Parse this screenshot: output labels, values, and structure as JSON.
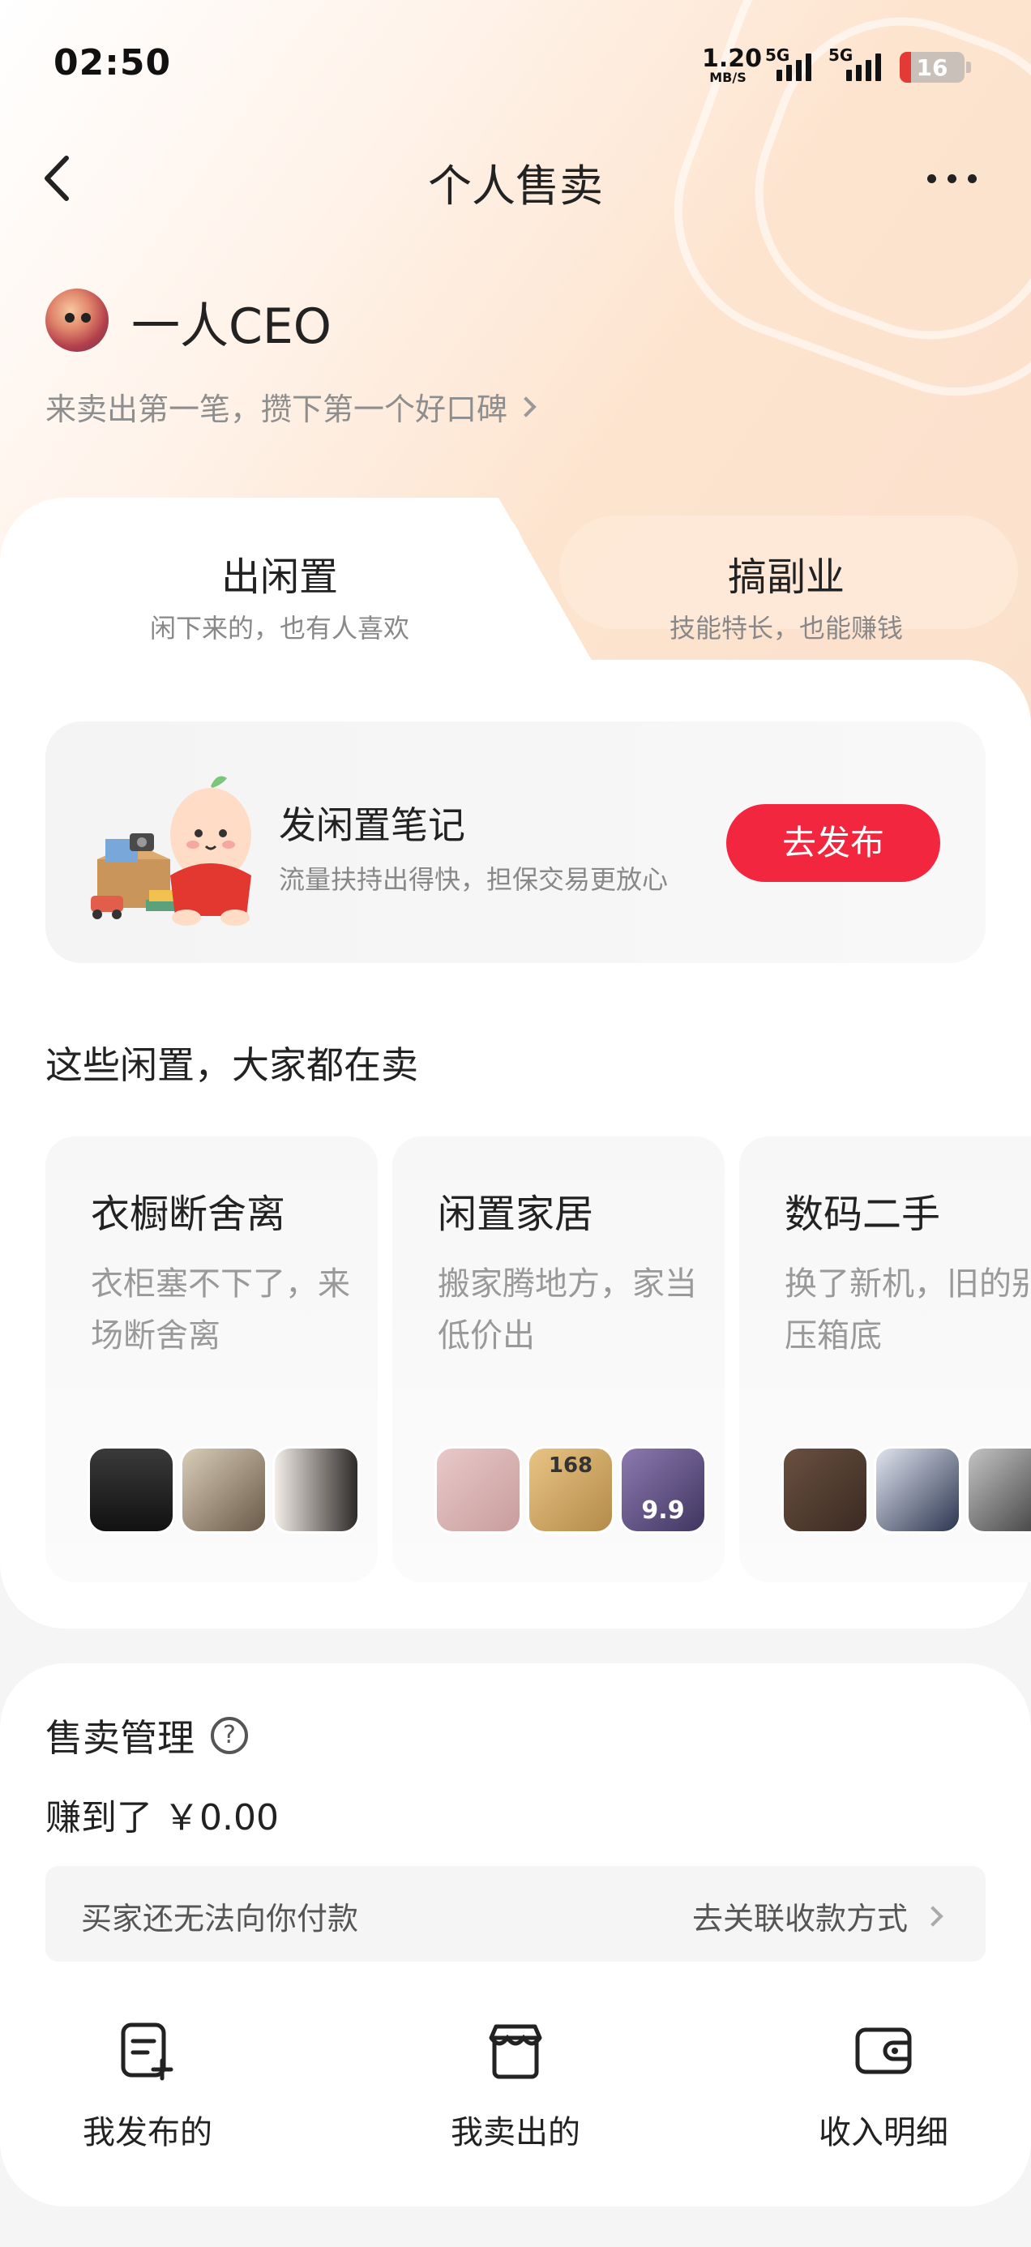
{
  "status_bar": {
    "time": "02:50",
    "net_speed_value": "1.20",
    "net_speed_unit": "MB/S",
    "signal1_label": "5G",
    "signal2_label": "5G",
    "battery": "16"
  },
  "nav": {
    "title": "个人售卖"
  },
  "profile": {
    "username": "一人CEO",
    "subtitle": "来卖出第一笔，攒下第一个好口碑"
  },
  "tabs": [
    {
      "title": "出闲置",
      "subtitle": "闲下来的，也有人喜欢"
    },
    {
      "title": "搞副业",
      "subtitle": "技能特长，也能赚钱"
    }
  ],
  "publish": {
    "title": "发闲置笔记",
    "subtitle": "流量扶持出得快，担保交易更放心",
    "button": "去发布"
  },
  "section_title": "这些闲置，大家都在卖",
  "categories": [
    {
      "title": "衣橱断舍离",
      "desc": "衣柜塞不下了，来场断舍离"
    },
    {
      "title": "闲置家居",
      "desc": "搬家腾地方，家当低价出",
      "thumb_labels": [
        "168",
        "9.9"
      ]
    },
    {
      "title": "数码二手",
      "desc": "换了新机，旧的别压箱底"
    }
  ],
  "sales": {
    "title": "售卖管理",
    "earned": "赚到了 ￥0.00",
    "pay_notice": "买家还无法向你付款",
    "pay_action": "去关联收款方式",
    "quick_actions": [
      {
        "label": "我发布的",
        "icon": "edit-note-icon"
      },
      {
        "label": "我卖出的",
        "icon": "store-box-icon"
      },
      {
        "label": "收入明细",
        "icon": "wallet-icon"
      }
    ]
  },
  "colors": {
    "accent": "#f3263f",
    "hero": "#fde4cf"
  }
}
